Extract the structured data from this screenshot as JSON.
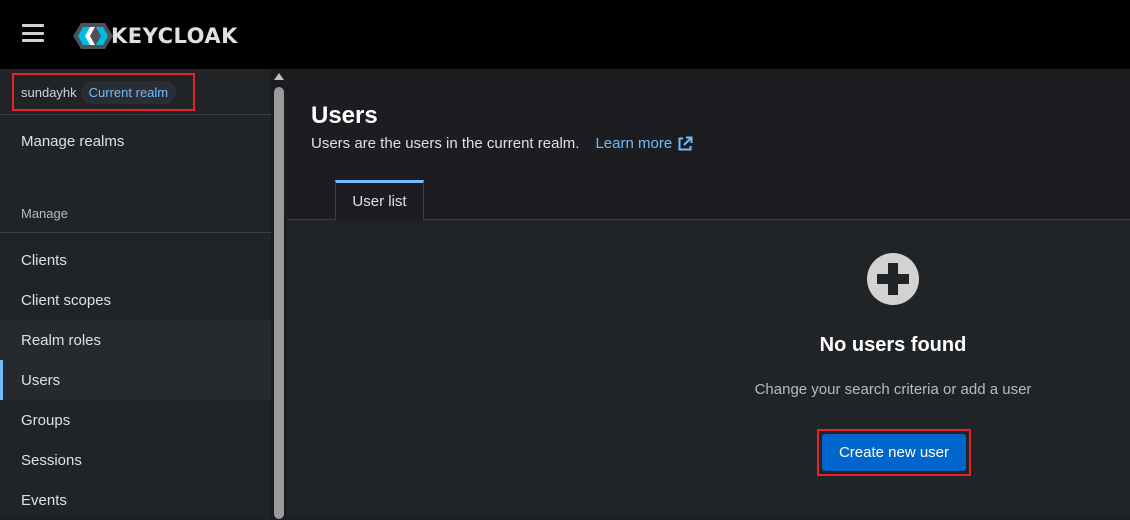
{
  "app": {
    "brand": "KEYCLOAK"
  },
  "realm": {
    "name": "sundayhk",
    "badge": "Current realm"
  },
  "sidebar": {
    "manage_realms": "Manage realms",
    "section_title": "Manage",
    "items": [
      {
        "label": "Clients"
      },
      {
        "label": "Client scopes"
      },
      {
        "label": "Realm roles"
      },
      {
        "label": "Users"
      },
      {
        "label": "Groups"
      },
      {
        "label": "Sessions"
      },
      {
        "label": "Events"
      }
    ]
  },
  "page": {
    "title": "Users",
    "description": "Users are the users in the current realm.",
    "learn_more": "Learn more"
  },
  "tabs": [
    {
      "label": "User list"
    }
  ],
  "empty_state": {
    "icon": "plus-circle-icon",
    "title": "No users found",
    "body": "Change your search criteria or add a user",
    "action": "Create new user"
  },
  "colors": {
    "accent": "#73bcf7",
    "primary_button": "#0066cc",
    "highlight_box": "#e8202a",
    "masthead": "#000000"
  }
}
